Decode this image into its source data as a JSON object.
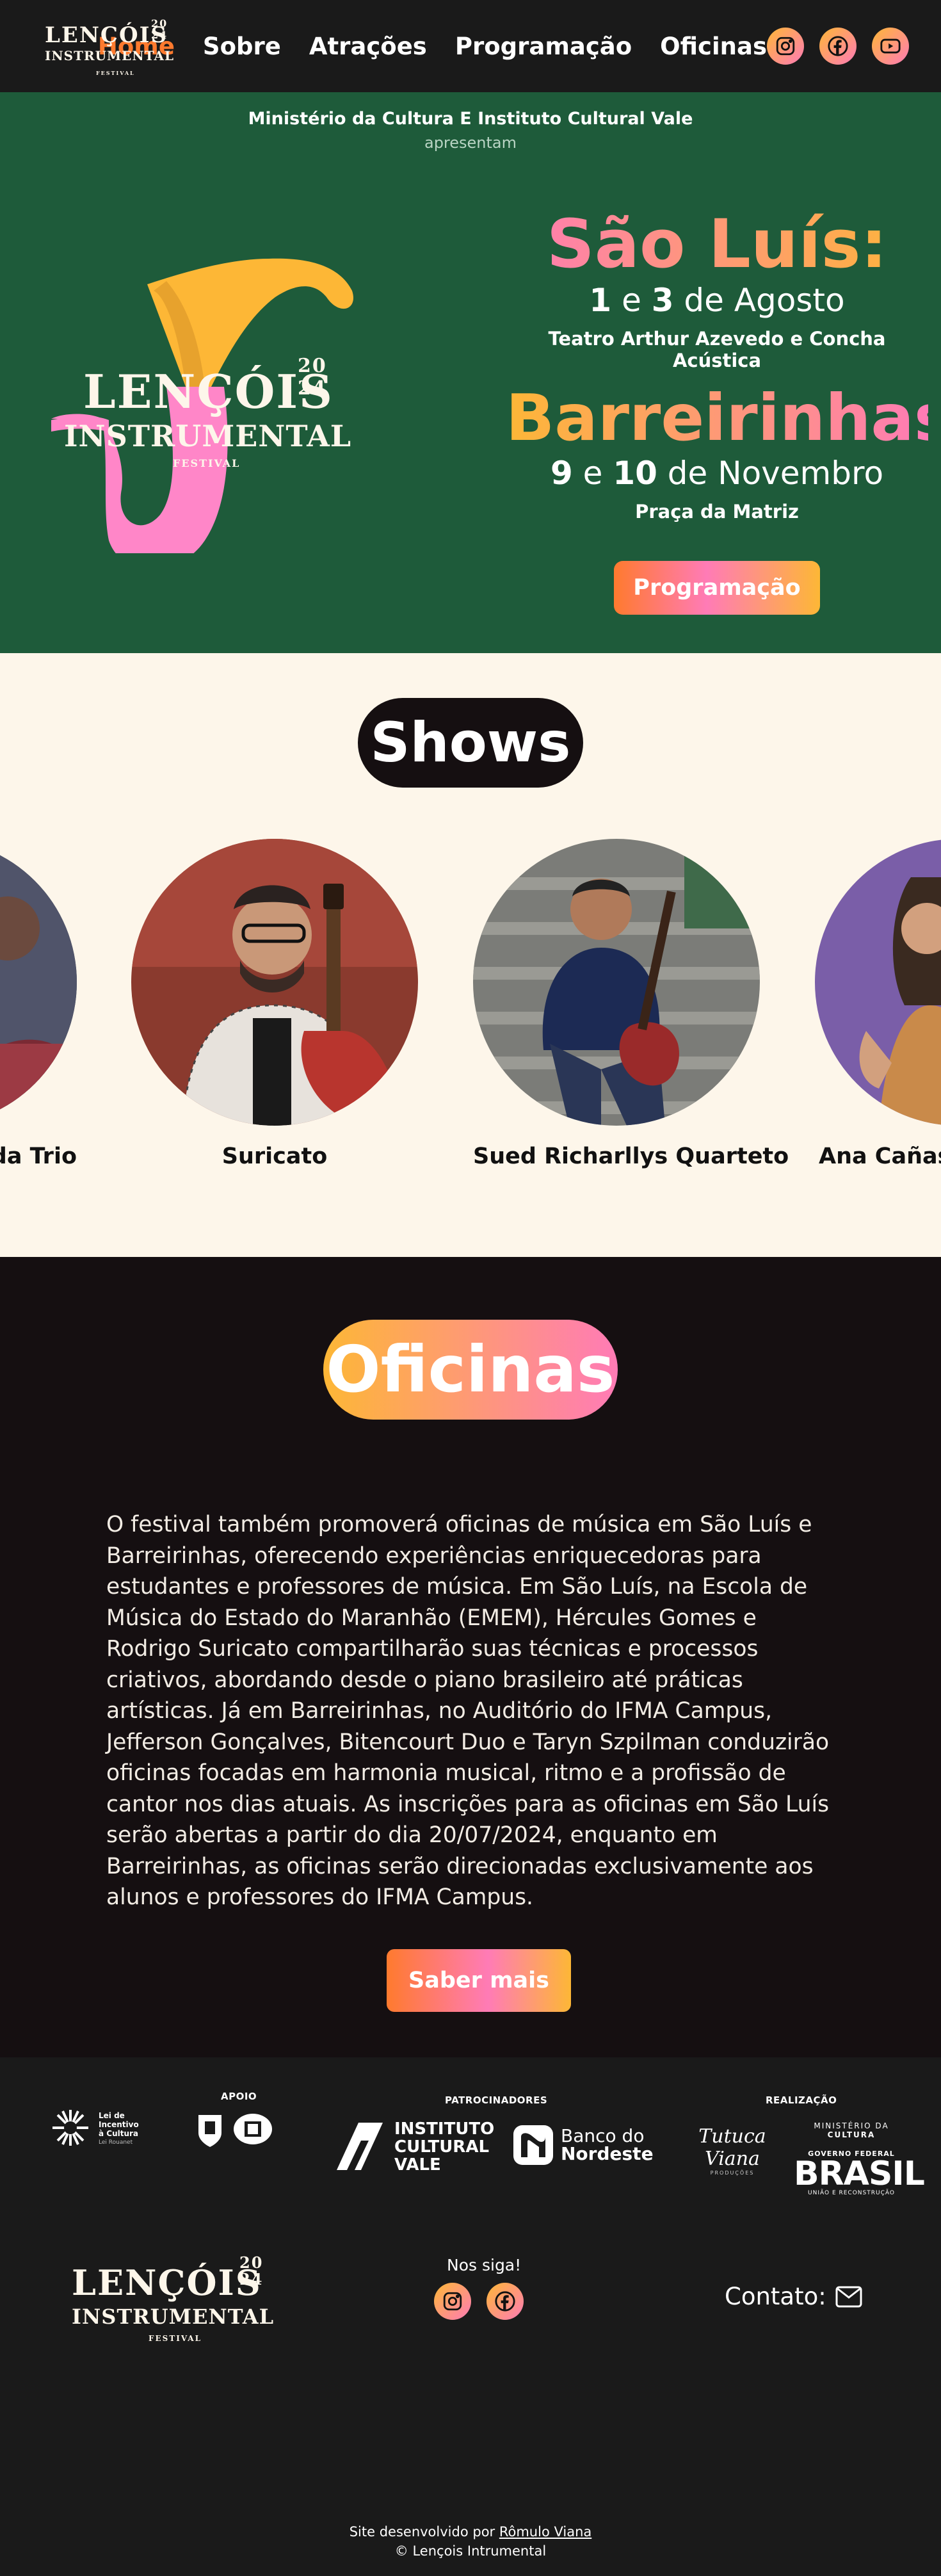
{
  "brand": {
    "logo_line1": "LENÇÓIS",
    "logo_line2": "INSTRUMENTAL",
    "logo_year_top": "20",
    "logo_year_bottom": "24",
    "logo_sub": "FESTIVAL"
  },
  "nav": {
    "items": [
      {
        "label": "Home",
        "active": true
      },
      {
        "label": "Sobre",
        "active": false
      },
      {
        "label": "Atrações",
        "active": false
      },
      {
        "label": "Programação",
        "active": false
      },
      {
        "label": "Oficinas",
        "active": false
      }
    ],
    "social": [
      "instagram-icon",
      "facebook-icon",
      "youtube-icon"
    ]
  },
  "hero": {
    "org": "Ministério da Cultura E Instituto Cultural Vale",
    "presents": "apresentam",
    "city1": "São Luís:",
    "dates1_bold1": "1",
    "dates1_mid": " e ",
    "dates1_bold2": "3",
    "dates1_month": " de Agosto",
    "venue1": "Teatro Arthur Azevedo e Concha Acústica",
    "city2": "Barreirinhas:",
    "dates2_bold1": "9",
    "dates2_mid": " e ",
    "dates2_bold2": "10",
    "dates2_month": " de Novembro",
    "venue2": "Praça da Matriz",
    "button": "Programação"
  },
  "shows": {
    "title": "Shows",
    "artists": [
      {
        "name": "da Trio"
      },
      {
        "name": "Suricato"
      },
      {
        "name": "Sued Richarllys Quarteto"
      },
      {
        "name": "Ana Cañas"
      }
    ]
  },
  "oficinas": {
    "title": "Oficinas",
    "text": "O festival também promoverá oficinas de música em São Luís e Barreirinhas, oferecendo experiências enriquecedoras para estudantes e professores de música. Em São Luís, na Escola de Música do Estado do Maranhão (EMEM), Hércules Gomes e Rodrigo Suricato compartilharão suas técnicas e processos criativos, abordando desde o piano brasileiro até práticas artísticas. Já em Barreirinhas, no Auditório do IFMA Campus, Jefferson Gonçalves, Bitencourt Duo e Taryn Szpilman conduzirão oficinas focadas em harmonia musical, ritmo e a profissão de cantor nos dias atuais. As inscrições para as oficinas em São Luís serão abertas a partir do dia 20/07/2024, enquanto em Barreirinhas, as oficinas serão direcionadas exclusivamente aos alunos e professores do IFMA Campus.",
    "button": "Saber mais"
  },
  "sponsors": {
    "lei_line1": "Lei de",
    "lei_line2": "Incentivo",
    "lei_line3": "à Cultura",
    "lei_line4": "Lei Rouanet",
    "apoio": "APOIO",
    "patrocinadores": "PATROCINADORES",
    "vale_line1": "INSTITUTO",
    "vale_line2": "CULTURAL",
    "vale_line3": "VALE",
    "bnb_line1": "Banco do",
    "bnb_line2": "Nordeste",
    "realizacao": "REALIZAÇÃO",
    "tutuca": "Tutuca Viana",
    "tutuca_sub": "PRODUÇÕES",
    "minc_line1": "MINISTÉRIO DA",
    "minc_line2": "CULTURA",
    "gov_line1": "GOVERNO FEDERAL",
    "gov_brasil": "BRASIL",
    "gov_line2": "UNIÃO E RECONSTRUÇÃO"
  },
  "footer": {
    "follow": "Nos siga!",
    "contact": "Contato:",
    "credits_prefix": "Site desenvolvido por ",
    "credits_author": "Rômulo Viana",
    "copyright": "© Lençois Intrumental"
  },
  "colors": {
    "accent_orange": "#ff7a2e",
    "pink": "#ff7bb6",
    "yellow": "#fdb736",
    "hero_green": "#1e5b3a",
    "cream": "#fdf6ea",
    "dark": "#150f11"
  }
}
